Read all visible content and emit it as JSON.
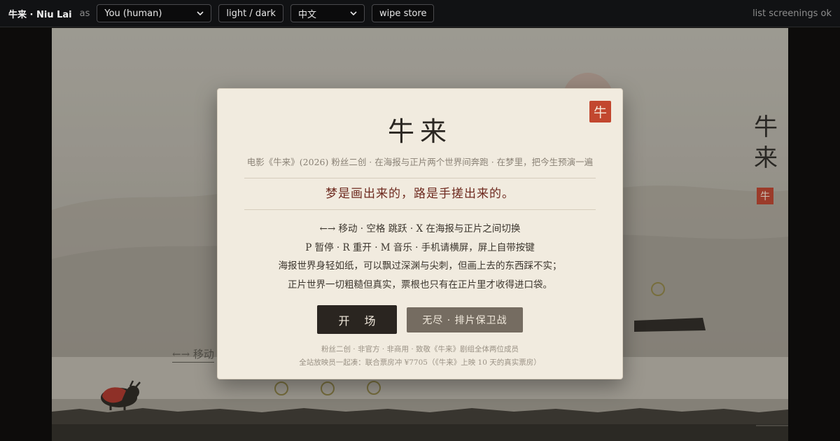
{
  "topbar": {
    "brand": "牛来 · Niu Lai",
    "as_label": "as",
    "role_select": "You (human)",
    "theme_button": "light / dark",
    "lang_select": "中文",
    "wipe_button": "wipe store",
    "status": "list screenings ok"
  },
  "scene": {
    "vertical_title": [
      "牛",
      "来"
    ],
    "seal": "牛",
    "hint": "←→ 移动"
  },
  "modal": {
    "seal": "牛",
    "title": "牛来",
    "subtitle": "电影《牛来》(2026) 粉丝二创 · 在海报与正片两个世界间奔跑 · 在梦里，把今生预演一遍",
    "tagline": "梦是画出来的，路是手搓出来的。",
    "instructions": [
      "←→ 移动 · 空格 跳跃 · X 在海报与正片之间切换",
      "P 暂停 · R 重开 · M 音乐 · 手机请横屏，屏上自带按键",
      "海报世界身轻如纸，可以飘过深渊与尖刺，但画上去的东西踩不实；",
      "正片世界一切粗糙但真实，票根也只有在正片里才收得进口袋。"
    ],
    "start_button": "开 场",
    "endless_button": "无尽 · 排片保卫战",
    "footer_line1": "粉丝二创 · 非官方 · 非商用 · 致敬《牛来》剧组全体两位成员",
    "footer_line2": "全站放映员一起凑：联合票房冲 ¥7705（《牛来》上映 10 天的真实票房）"
  },
  "colors": {
    "seal_red": "#c2472f",
    "modal_bg": "#f1ebdf",
    "tagline_red": "#6e2a1f",
    "start_btn": "#2a2520",
    "endless_btn": "#756c61"
  }
}
